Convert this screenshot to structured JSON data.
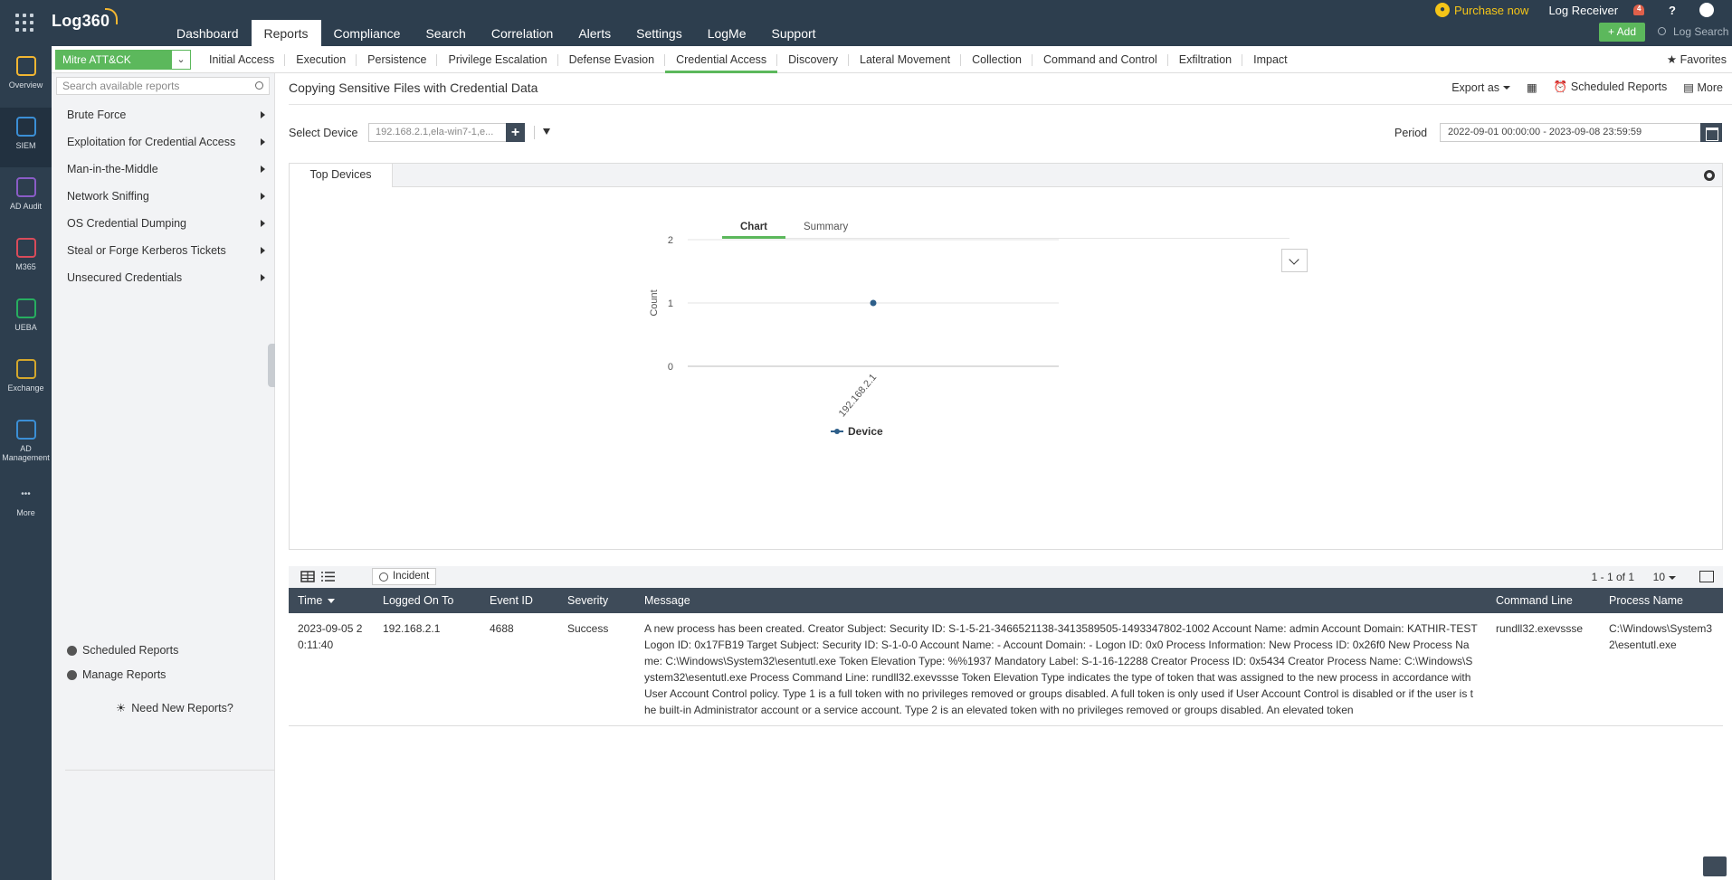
{
  "app": {
    "name": "Log360"
  },
  "top_nav": {
    "tabs": [
      "Dashboard",
      "Reports",
      "Compliance",
      "Search",
      "Correlation",
      "Alerts",
      "Settings",
      "LogMe",
      "Support"
    ],
    "active": "Reports",
    "purchase_label": "Purchase now",
    "log_receiver_label": "Log Receiver",
    "notification_count": "4",
    "help_label": "?",
    "add_label": "+ Add",
    "log_search_placeholder": "Log Search"
  },
  "rail": {
    "items": [
      {
        "label": "Overview",
        "icon": "overview-icon",
        "color": "#f2b632"
      },
      {
        "label": "SIEM",
        "icon": "siem-icon",
        "color": "#3b8fd6"
      },
      {
        "label": "AD Audit",
        "icon": "ad-audit-icon",
        "color": "#8a5cc7"
      },
      {
        "label": "M365",
        "icon": "m365-icon",
        "color": "#d94b5a"
      },
      {
        "label": "UEBA",
        "icon": "ueba-icon",
        "color": "#27ae60"
      },
      {
        "label": "Exchange",
        "icon": "exchange-icon",
        "color": "#d4a72c"
      },
      {
        "label": "AD Management",
        "icon": "ad-management-icon",
        "color": "#3b8fd6"
      },
      {
        "label": "More",
        "icon": "more-icon",
        "color": "#c9d2da"
      }
    ],
    "active": "SIEM"
  },
  "sub_nav": {
    "category_select": "Mitre ATT&CK",
    "tabs": [
      "Initial Access",
      "Execution",
      "Persistence",
      "Privilege Escalation",
      "Defense Evasion",
      "Credential Access",
      "Discovery",
      "Lateral Movement",
      "Collection",
      "Command and Control",
      "Exfiltration",
      "Impact"
    ],
    "active": "Credential Access",
    "favorites_label": "Favorites"
  },
  "sidebar": {
    "search_placeholder": "Search available reports",
    "categories": [
      "Brute Force",
      "Exploitation for Credential Access",
      "Man-in-the-Middle",
      "Network Sniffing",
      "OS Credential Dumping",
      "Steal or Forge Kerberos Tickets",
      "Unsecured Credentials"
    ],
    "scheduled_reports": "Scheduled Reports",
    "manage_reports": "Manage Reports",
    "need_new_reports": "Need New Reports?"
  },
  "report": {
    "title": "Copying Sensitive Files with Credential Data",
    "export_label": "Export as",
    "scheduled_label": "Scheduled Reports",
    "more_label": "More",
    "select_device_label": "Select Device",
    "device_value": "192.168.2.1,ela-win7-1,e...",
    "period_label": "Period",
    "period_value": "2022-09-01 00:00:00 - 2023-09-08 23:59:59",
    "panel_tab": "Top Devices",
    "chart_tab": "Chart",
    "summary_tab": "Summary"
  },
  "chart_data": {
    "type": "line",
    "categories": [
      "192.168.2.1"
    ],
    "series": [
      {
        "name": "Device",
        "values": [
          1
        ],
        "color": "#2e5f8a"
      }
    ],
    "xlabel": "",
    "ylabel": "Count",
    "ylim": [
      0,
      2
    ],
    "yticks": [
      0,
      1,
      2
    ],
    "grid": true,
    "legend": "bottom"
  },
  "table": {
    "incident_label": "Incident",
    "pager": "1 - 1 of 1",
    "per_page": "10",
    "columns": [
      "Time",
      "Logged On To",
      "Event ID",
      "Severity",
      "Message",
      "Command Line",
      "Process Name"
    ],
    "rows": [
      {
        "time": "2023-09-05 20:11:40",
        "logged_on_to": "192.168.2.1",
        "event_id": "4688",
        "severity": "Success",
        "message": "A new process has been created. Creator Subject: Security ID: S-1-5-21-3466521138-3413589505-1493347802-1002 Account Name: admin Account Domain: KATHIR-TEST Logon ID: 0x17FB19 Target Subject: Security ID: S-1-0-0 Account Name: - Account Domain: - Logon ID: 0x0 Process Information: New Process ID: 0x26f0 New Process Name: C:\\Windows\\System32\\esentutl.exe Token Elevation Type: %%1937 Mandatory Label: S-1-16-12288 Creator Process ID: 0x5434 Creator Process Name: C:\\Windows\\System32\\esentutl.exe Process Command Line: rundll32.exevssse Token Elevation Type indicates the type of token that was assigned to the new process in accordance with User Account Control policy. Type 1 is a full token with no privileges removed or groups disabled. A full token is only used if User Account Control is disabled or if the user is the built-in Administrator account or a service account. Type 2 is an elevated token with no privileges removed or groups disabled. An elevated token",
        "command_line": "rundll32.exevssse",
        "process_name": "C:\\Windows\\System32\\esentutl.exe"
      }
    ]
  }
}
